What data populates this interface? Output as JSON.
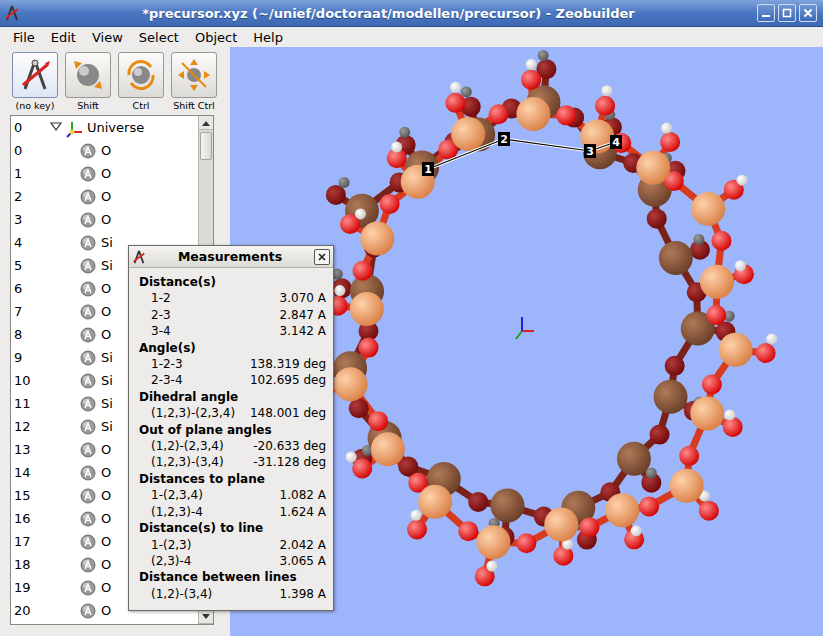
{
  "window": {
    "title": "*precursor.xyz (~/unief/doctoraat/modellen/precursor) - Zeobuilder"
  },
  "menu": [
    "File",
    "Edit",
    "View",
    "Select",
    "Object",
    "Help"
  ],
  "toolbar": [
    {
      "label": "(no key)",
      "selected": true
    },
    {
      "label": "Shift",
      "selected": false
    },
    {
      "label": "Ctrl",
      "selected": false
    },
    {
      "label": "Shift Ctrl",
      "selected": false
    }
  ],
  "tree": {
    "root": {
      "index": "0",
      "label": "Universe",
      "expanded": true
    },
    "items": [
      {
        "index": "0",
        "label": "O"
      },
      {
        "index": "1",
        "label": "O"
      },
      {
        "index": "2",
        "label": "O"
      },
      {
        "index": "3",
        "label": "O"
      },
      {
        "index": "4",
        "label": "Si"
      },
      {
        "index": "5",
        "label": "Si"
      },
      {
        "index": "6",
        "label": "O"
      },
      {
        "index": "7",
        "label": "O"
      },
      {
        "index": "8",
        "label": "O"
      },
      {
        "index": "9",
        "label": "Si"
      },
      {
        "index": "10",
        "label": "Si"
      },
      {
        "index": "11",
        "label": "Si"
      },
      {
        "index": "12",
        "label": "Si"
      },
      {
        "index": "13",
        "label": "O"
      },
      {
        "index": "14",
        "label": "O"
      },
      {
        "index": "15",
        "label": "O"
      },
      {
        "index": "16",
        "label": "O"
      },
      {
        "index": "17",
        "label": "O"
      },
      {
        "index": "18",
        "label": "O"
      },
      {
        "index": "19",
        "label": "O"
      },
      {
        "index": "20",
        "label": "O"
      }
    ]
  },
  "viewport": {
    "markers": [
      "1",
      "2",
      "3",
      "4"
    ]
  },
  "measurements": {
    "title": "Measurements",
    "sections": [
      {
        "heading": "Distance(s)",
        "rows": [
          {
            "label": "1-2",
            "value": "3.070 A"
          },
          {
            "label": "2-3",
            "value": "2.847 A"
          },
          {
            "label": "3-4",
            "value": "3.142 A"
          }
        ]
      },
      {
        "heading": "Angle(s)",
        "rows": [
          {
            "label": "1-2-3",
            "value": "138.319 deg"
          },
          {
            "label": "2-3-4",
            "value": "102.695 deg"
          }
        ]
      },
      {
        "heading": "Dihedral angle",
        "rows": [
          {
            "label": "(1,2,3)-(2,3,4)",
            "value": "148.001 deg"
          }
        ]
      },
      {
        "heading": "Out of plane angles",
        "rows": [
          {
            "label": "(1,2)-(2,3,4)",
            "value": "-20.633 deg"
          },
          {
            "label": "(1,2,3)-(3,4)",
            "value": "-31.128 deg"
          }
        ]
      },
      {
        "heading": "Distances to plane",
        "rows": [
          {
            "label": "1-(2,3,4)",
            "value": "1.082 A"
          },
          {
            "label": "(1,2,3)-4",
            "value": "1.624 A"
          }
        ]
      },
      {
        "heading": "Distance(s) to line",
        "rows": [
          {
            "label": "1-(2,3)",
            "value": "2.042 A"
          },
          {
            "label": "(2,3)-4",
            "value": "3.065 A"
          }
        ]
      },
      {
        "heading": "Distance between lines",
        "rows": [
          {
            "label": "(1,2)-(3,4)",
            "value": "1.398 A"
          }
        ]
      }
    ]
  }
}
